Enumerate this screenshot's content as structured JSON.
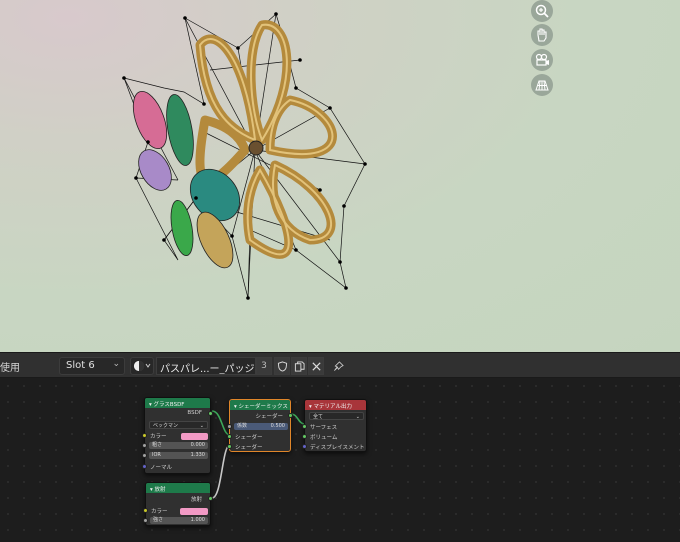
{
  "header": {
    "use_label": "使用",
    "slot": "Slot 6",
    "material_name": "パスパレ...ー_パッジ7",
    "user_count": "3"
  },
  "viewport_nav": [
    "zoom-icon",
    "hand-pan-icon",
    "camera-icon",
    "grid-ortho-icon"
  ],
  "nodes": {
    "glass": {
      "title": "グラスBSDF",
      "output": "BSDF",
      "distribution": "ベックマン",
      "color_label": "カラー",
      "roughness_label": "粗さ",
      "roughness_value": "0.000",
      "ior_label": "IOR",
      "ior_value": "1.330",
      "normal_label": "ノーマル",
      "color": "#f29ac5",
      "header_color": "#1e7a4a"
    },
    "emission": {
      "title": "放射",
      "output": "放射",
      "color_label": "カラー",
      "strength_label": "強さ",
      "strength_value": "1.000",
      "color": "#f29ac5",
      "header_color": "#1e7a4a"
    },
    "mix": {
      "title": "シェーダーミックス",
      "output": "シェーダー",
      "fac_label": "係数",
      "fac_value": "0.500",
      "shader1": "シェーダー",
      "shader2": "シェーダー",
      "header_color": "#1e7a4a"
    },
    "output": {
      "title": "マテリアル出力",
      "target": "全て",
      "surface": "サーフェス",
      "volume": "ボリューム",
      "displacement": "ディスプレイスメント",
      "header_color": "#a8353a"
    }
  }
}
